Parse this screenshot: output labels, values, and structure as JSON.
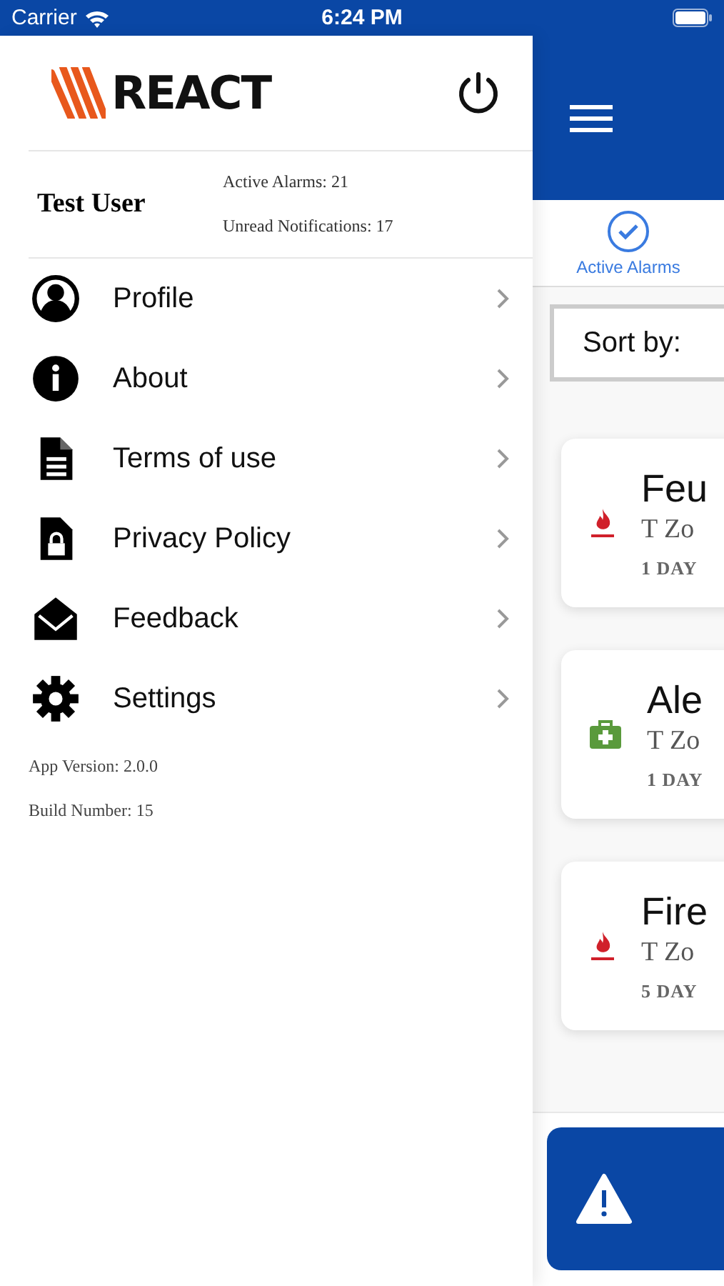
{
  "status_bar": {
    "carrier": "Carrier",
    "time": "6:24 PM"
  },
  "drawer": {
    "logo": "REACT",
    "user": {
      "name": "Test User",
      "active_alarms": "Active Alarms: 21",
      "unread_notifications": "Unread Notifications: 17"
    },
    "menu": [
      {
        "label": "Profile"
      },
      {
        "label": "About"
      },
      {
        "label": "Terms of use"
      },
      {
        "label": "Privacy Policy"
      },
      {
        "label": "Feedback"
      },
      {
        "label": "Settings"
      }
    ],
    "app_version": "App Version: 2.0.0",
    "build_number": "Build Number: 15"
  },
  "main": {
    "tab": {
      "label": "Active Alarms",
      "selected": true
    },
    "sort": {
      "label": "Sort by:"
    },
    "alarms": [
      {
        "kind": "fire",
        "title": "Feu",
        "zone": "T Zo",
        "age": "1 DAY"
      },
      {
        "kind": "medical",
        "title": "Ale",
        "zone": "T Zo",
        "age": "1 DAY"
      },
      {
        "kind": "fire",
        "title": "Fire",
        "zone": "T Zo",
        "age": "5 DAY"
      }
    ]
  }
}
